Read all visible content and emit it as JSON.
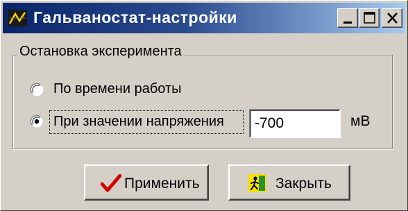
{
  "window": {
    "title": "Гальваностат-настройки",
    "controls": {
      "minimize_icon": "minimize-icon",
      "maximize_icon": "maximize-icon",
      "close_icon": "close-icon"
    }
  },
  "stop_group": {
    "title": "Остановка эксперимента",
    "options": [
      {
        "label": "По времени работы",
        "selected": false
      },
      {
        "label": "При значении напряжения",
        "selected": true
      }
    ],
    "voltage_value": "-700",
    "voltage_unit": "мВ"
  },
  "buttons": {
    "apply": {
      "label": "Применить",
      "icon": "checkmark-icon"
    },
    "close": {
      "label": "Закрыть",
      "icon": "exit-icon"
    }
  },
  "colors": {
    "titlebar_start": "#0a246a",
    "titlebar_end": "#a6caf0",
    "face": "#d4d0c8",
    "check": "#d40000"
  }
}
